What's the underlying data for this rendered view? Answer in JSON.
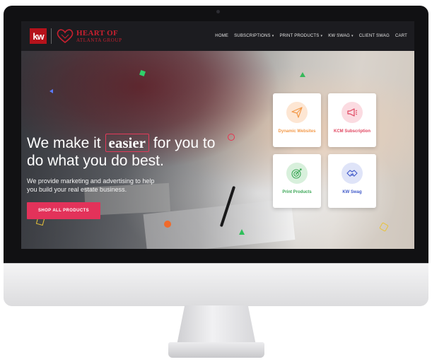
{
  "brand": {
    "kw_logo": "kw",
    "name_top": "HEART OF",
    "name_bottom": "ATLANTA GROUP",
    "heart_icon": "heart-outline-icon"
  },
  "nav": {
    "items": [
      {
        "label": "HOME",
        "has_dropdown": false
      },
      {
        "label": "SUBSCRIPTIONS",
        "has_dropdown": true
      },
      {
        "label": "PRINT PRODUCTS",
        "has_dropdown": true
      },
      {
        "label": "KW SWAG",
        "has_dropdown": true
      },
      {
        "label": "CLIENT SWAG",
        "has_dropdown": false
      },
      {
        "label": "CART",
        "has_dropdown": false
      }
    ]
  },
  "hero": {
    "headline_before": "We make it",
    "headline_highlight": "easier",
    "headline_after": "for you to do what you do best.",
    "subtext": "We provide marketing and advertising to help you build your real estate business.",
    "cta_label": "SHOP ALL PRODUCTS"
  },
  "cards": [
    {
      "label": "Dynamic Websites",
      "icon": "paper-plane-icon",
      "color": "#f39a4a",
      "bg": "#fde6d3"
    },
    {
      "label": "KCM Subscription",
      "icon": "megaphone-icon",
      "color": "#e0455f",
      "bg": "#fbdbe1"
    },
    {
      "label": "Print Products",
      "icon": "target-icon",
      "color": "#3aa655",
      "bg": "#d8f0dc"
    },
    {
      "label": "KW Swag",
      "icon": "handshake-icon",
      "color": "#3f59c9",
      "bg": "#dfe4f8"
    }
  ],
  "colors": {
    "accent": "#e3325a",
    "brand_red": "#c8202f",
    "nav_bg": "#1c1c20"
  }
}
